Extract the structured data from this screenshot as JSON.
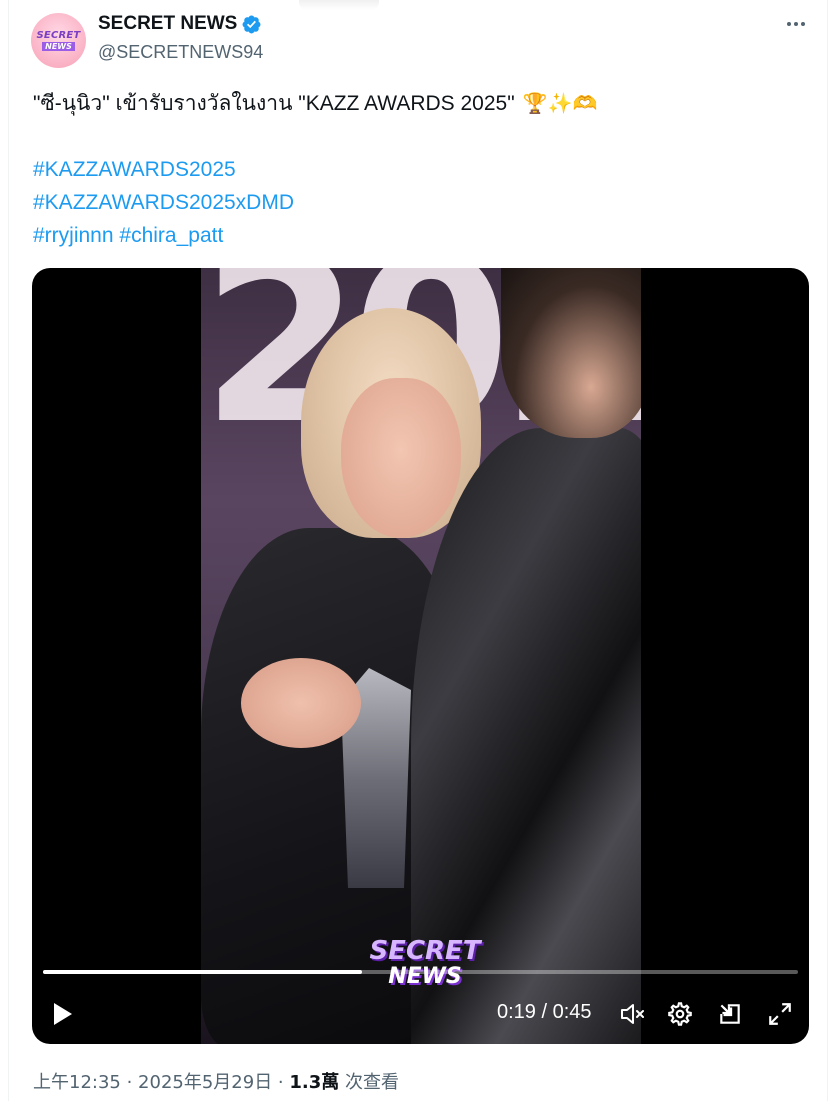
{
  "author": {
    "display_name": "SECRET NEWS",
    "handle": "@SECRETNEWS94",
    "avatar_text_1": "SECRET",
    "avatar_text_2": "NEWS",
    "verified_icon": "verified-badge-icon",
    "accent_color": "#1d9bf0"
  },
  "tweet": {
    "text": "\"ซี-นุนิว\" เข้ารับรางวัลในงาน \"KAZZ AWARDS 2025\"",
    "emojis": "🏆✨🫶",
    "hashtags": [
      "#KAZZAWARDS2025",
      "#KAZZAWARDS2025xDMD"
    ],
    "hashtag_line3": [
      "#rryjinnn",
      "#chira_patt"
    ]
  },
  "video": {
    "watermark_1": "SECRET",
    "watermark_2": "NEWS",
    "current_time": "0:19",
    "duration": "0:45",
    "time_display": "0:19 / 0:45",
    "progress": 0.422,
    "controls": [
      "play-icon",
      "volume-icon",
      "settings-icon",
      "picture-in-picture-icon",
      "fullscreen-icon"
    ]
  },
  "meta": {
    "time_date": "上午12:35 · 2025年5月29日 · ",
    "views_count": "1.3萬",
    "views_label": " 次查看"
  }
}
